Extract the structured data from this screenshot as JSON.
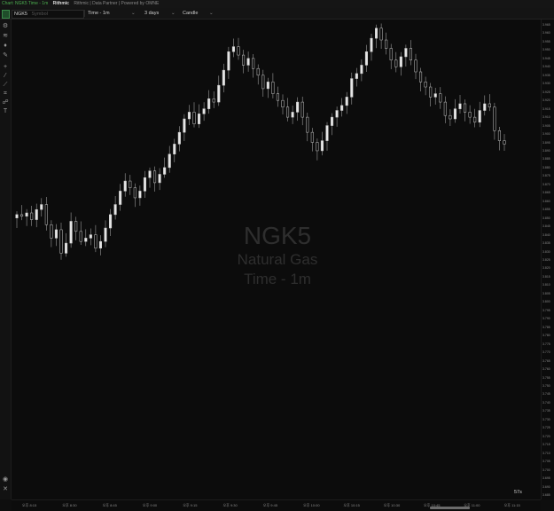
{
  "titlebar": {
    "window_title": "Chart: NGK5 Time - 1m",
    "provider": "Rithmic",
    "trademark_text": "Rithmic | Data Partner | Powered by OMNE",
    "powered_by": "Powered by OMNE"
  },
  "toolbar": {
    "symbol": "NGK5",
    "symbol_placeholder": "Symbol",
    "interval": "Time - 1m",
    "range": "3 days",
    "style": "Candle"
  },
  "watermark": {
    "symbol": "NGK5",
    "name": "Natural Gas",
    "interval": "Time - 1m"
  },
  "countdown": "57s",
  "chart_data": {
    "type": "candlestick",
    "symbol": "NGK5",
    "interval": "1m",
    "y_ticks": [
      "3.965",
      "3.960",
      "3.955",
      "3.950",
      "3.945",
      "3.940",
      "3.935",
      "3.930",
      "3.925",
      "3.920",
      "3.915",
      "3.910",
      "3.905",
      "3.900",
      "3.895",
      "3.890",
      "3.885",
      "3.880",
      "3.875",
      "3.870",
      "3.865",
      "3.860",
      "3.855",
      "3.850",
      "3.845",
      "3.840",
      "3.835",
      "3.830",
      "3.825",
      "3.820",
      "3.815",
      "3.810",
      "3.805",
      "3.800",
      "3.795",
      "3.790",
      "3.785",
      "3.780",
      "3.775",
      "3.770",
      "3.765",
      "3.760",
      "3.755",
      "3.750",
      "3.745",
      "3.740",
      "3.735",
      "3.730",
      "3.725",
      "3.720",
      "3.715",
      "3.710",
      "3.705",
      "3.700",
      "3.695",
      "3.690",
      "3.685"
    ],
    "ylim": [
      3.685,
      3.965
    ],
    "x_ticks": [
      "오후 8:15",
      "오후 8:30",
      "오후 8:45",
      "오후 9:00",
      "오후 9:15",
      "오후 9:30",
      "오후 9:45",
      "오후 10:00",
      "오후 10:15",
      "오후 10:30",
      "오후 10:45",
      "오후 11:00",
      "오후 11:15"
    ],
    "closes": [
      3.852,
      3.851,
      3.853,
      3.849,
      3.855,
      3.858,
      3.846,
      3.838,
      3.843,
      3.829,
      3.835,
      3.848,
      3.842,
      3.836,
      3.838,
      3.84,
      3.832,
      3.836,
      3.844,
      3.852,
      3.858,
      3.866,
      3.872,
      3.868,
      3.862,
      3.866,
      3.874,
      3.878,
      3.871,
      3.876,
      3.88,
      3.888,
      3.894,
      3.901,
      3.909,
      3.913,
      3.906,
      3.912,
      3.915,
      3.921,
      3.919,
      3.929,
      3.938,
      3.949,
      3.952,
      3.947,
      3.941,
      3.945,
      3.939,
      3.935,
      3.927,
      3.931,
      3.924,
      3.92,
      3.916,
      3.91,
      3.913,
      3.919,
      3.91,
      3.901,
      3.895,
      3.89,
      3.896,
      3.905,
      3.91,
      3.914,
      3.917,
      3.922,
      3.933,
      3.936,
      3.941,
      3.949,
      3.957,
      3.963,
      3.956,
      3.951,
      3.944,
      3.94,
      3.946,
      3.951,
      3.944,
      3.937,
      3.931,
      3.928,
      3.922,
      3.924,
      3.919,
      3.911,
      3.909,
      3.915,
      3.918,
      3.913,
      3.91,
      3.907,
      3.914,
      3.918,
      3.916,
      3.902,
      3.896,
      3.894
    ]
  }
}
